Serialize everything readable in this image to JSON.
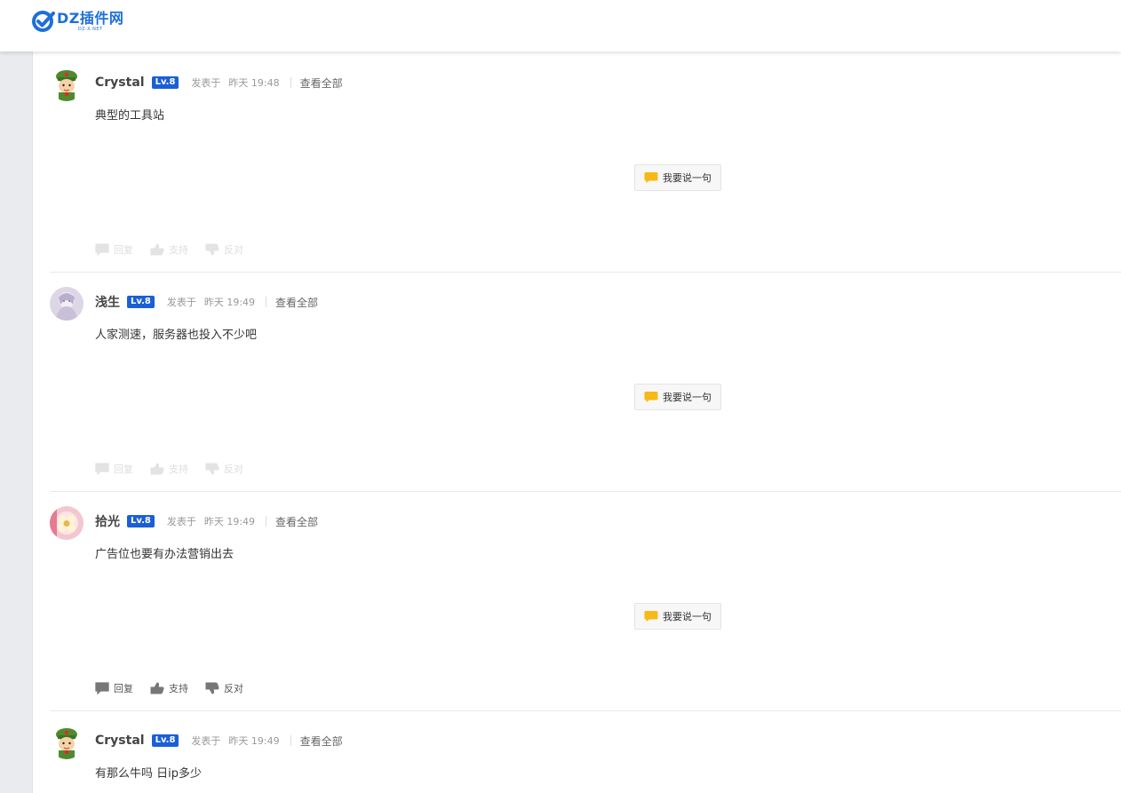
{
  "header": {
    "logo_text": "DZ插件网",
    "logo_sub": "DZ-X.NET"
  },
  "colors": {
    "brand_blue": "#1e6fd9",
    "level_badge": "#1a5fd6",
    "bubble_yellow": "#f6b915"
  },
  "posts": [
    {
      "username": "Crystal",
      "level": "Lv.8",
      "pub_prefix": "发表于",
      "time": "昨天 19:48",
      "view_all": "查看全部",
      "content": "典型的工具站",
      "say_button": "我要说一句",
      "actions": {
        "reply": "回复",
        "support": "支持",
        "oppose": "反对"
      },
      "actions_faded": true,
      "avatar": "soldier-avatar"
    },
    {
      "username": "浅生",
      "level": "Lv.8",
      "pub_prefix": "发表于",
      "time": "昨天 19:49",
      "view_all": "查看全部",
      "content": "人家测速，服务器也投入不少吧",
      "say_button": "我要说一句",
      "actions": {
        "reply": "回复",
        "support": "支持",
        "oppose": "反对"
      },
      "actions_faded": true,
      "avatar": "lilac-avatar"
    },
    {
      "username": "拾光",
      "level": "Lv.8",
      "pub_prefix": "发表于",
      "time": "昨天 19:49",
      "view_all": "查看全部",
      "content": "广告位也要有办法营销出去",
      "say_button": "我要说一句",
      "actions": {
        "reply": "回复",
        "support": "支持",
        "oppose": "反对"
      },
      "actions_faded": false,
      "avatar": "flower-avatar"
    },
    {
      "username": "Crystal",
      "level": "Lv.8",
      "pub_prefix": "发表于",
      "time": "昨天 19:49",
      "view_all": "查看全部",
      "content": "有那么牛吗 日ip多少",
      "avatar": "soldier-avatar"
    }
  ]
}
